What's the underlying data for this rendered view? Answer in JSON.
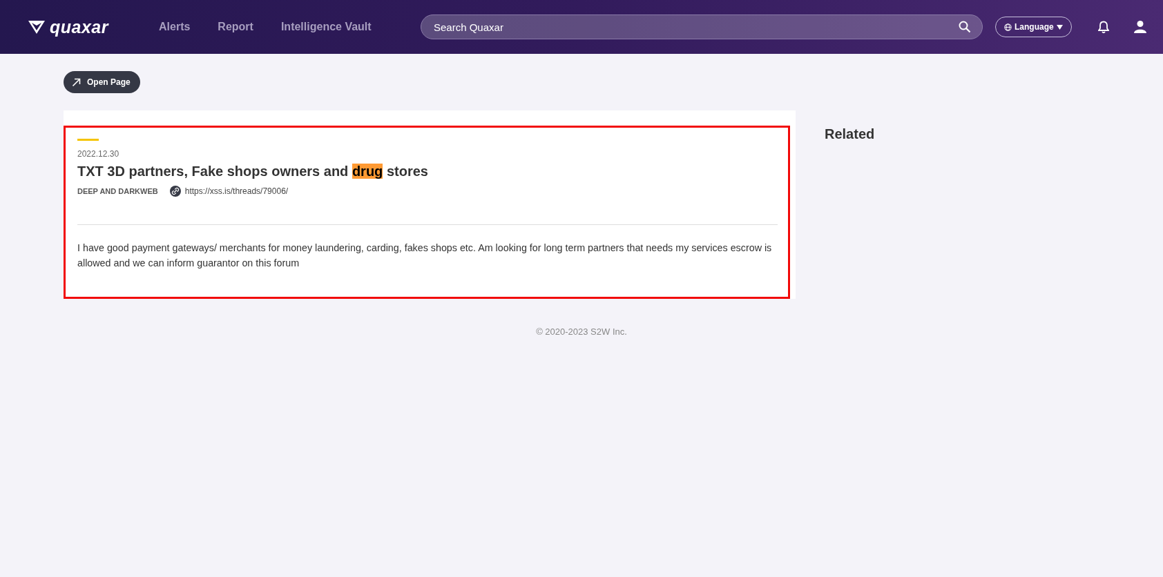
{
  "header": {
    "logo": "quaxar",
    "nav": [
      {
        "label": "Alerts"
      },
      {
        "label": "Report"
      },
      {
        "label": "Intelligence Vault"
      }
    ],
    "search": {
      "placeholder": "Search Quaxar"
    },
    "language": "Language"
  },
  "open_page": "Open Page",
  "post": {
    "date": "2022.12.30",
    "title": [
      {
        "text": "TXT 3D partners, Fake shops owners and ",
        "highlighted": false
      },
      {
        "text": "drug",
        "highlighted": true
      },
      {
        "text": " stores",
        "highlighted": false
      }
    ],
    "source": "DEEP AND DARKWEB",
    "url": "https://xss.is/threads/79006/",
    "body": "I have good payment gateways/ merchants for money laundering, carding, fakes shops etc. Am looking for long term partners that needs my services escrow is allowed and we can inform guarantor on this forum"
  },
  "related": {
    "title": "Related"
  },
  "footer": "© 2020-2023 S2W Inc."
}
